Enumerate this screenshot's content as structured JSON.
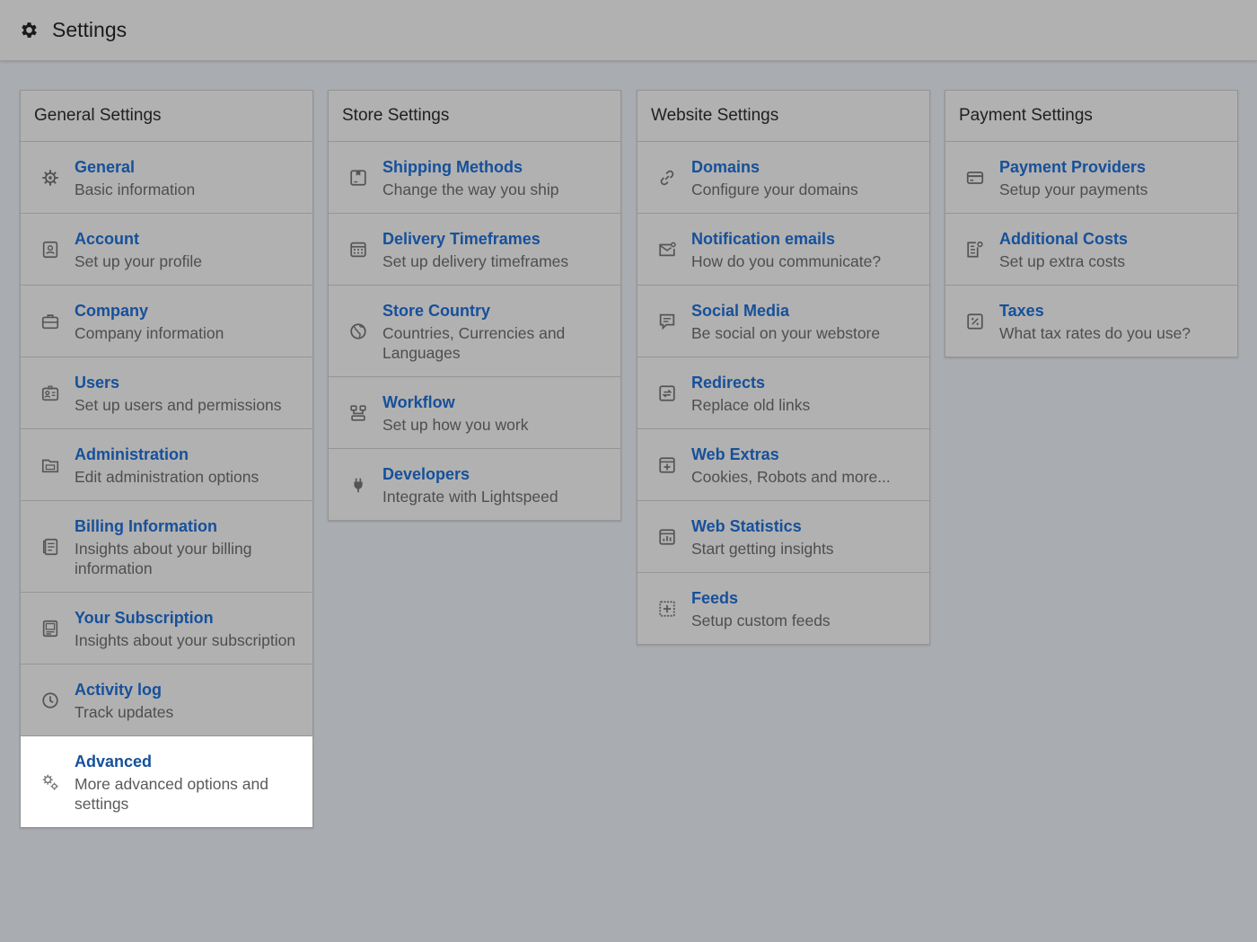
{
  "header": {
    "title": "Settings",
    "icon": "gear-icon"
  },
  "columns": [
    {
      "title": "General Settings",
      "items": [
        {
          "label": "General",
          "desc": "Basic information",
          "icon": "gear-icon"
        },
        {
          "label": "Account",
          "desc": "Set up your profile",
          "icon": "account-icon"
        },
        {
          "label": "Company",
          "desc": "Company information",
          "icon": "briefcase-icon"
        },
        {
          "label": "Users",
          "desc": "Set up users and permissions",
          "icon": "users-icon"
        },
        {
          "label": "Administration",
          "desc": "Edit administration options",
          "icon": "folder-icon"
        },
        {
          "label": "Billing Information",
          "desc": "Insights about your billing information",
          "icon": "billing-icon"
        },
        {
          "label": "Your Subscription",
          "desc": "Insights about your subscription",
          "icon": "subscription-icon"
        },
        {
          "label": "Activity log",
          "desc": "Track updates",
          "icon": "clock-icon"
        },
        {
          "label": "Advanced",
          "desc": "More advanced options and settings",
          "icon": "gears-icon"
        }
      ]
    },
    {
      "title": "Store Settings",
      "items": [
        {
          "label": "Shipping Methods",
          "desc": "Change the way you ship",
          "icon": "box-icon"
        },
        {
          "label": "Delivery Timeframes",
          "desc": "Set up delivery timeframes",
          "icon": "calendar-icon"
        },
        {
          "label": "Store Country",
          "desc": "Countries, Currencies and Languages",
          "icon": "globe-icon"
        },
        {
          "label": "Workflow",
          "desc": "Set up how you work",
          "icon": "workflow-icon"
        },
        {
          "label": "Developers",
          "desc": "Integrate with Lightspeed",
          "icon": "plug-icon"
        }
      ]
    },
    {
      "title": "Website Settings",
      "items": [
        {
          "label": "Domains",
          "desc": "Configure your domains",
          "icon": "link-icon"
        },
        {
          "label": "Notification emails",
          "desc": "How do you communicate?",
          "icon": "mail-icon"
        },
        {
          "label": "Social Media",
          "desc": "Be social on your webstore",
          "icon": "chat-icon"
        },
        {
          "label": "Redirects",
          "desc": "Replace old links",
          "icon": "redirect-icon"
        },
        {
          "label": "Web Extras",
          "desc": "Cookies, Robots and more...",
          "icon": "plus-box-icon"
        },
        {
          "label": "Web Statistics",
          "desc": "Start getting insights",
          "icon": "stats-icon"
        },
        {
          "label": "Feeds",
          "desc": "Setup custom feeds",
          "icon": "feeds-icon"
        }
      ]
    },
    {
      "title": "Payment Settings",
      "items": [
        {
          "label": "Payment Providers",
          "desc": "Setup your payments",
          "icon": "card-icon"
        },
        {
          "label": "Additional Costs",
          "desc": "Set up extra costs",
          "icon": "costs-icon"
        },
        {
          "label": "Taxes",
          "desc": "What tax rates do you use?",
          "icon": "percent-icon"
        }
      ]
    }
  ]
}
